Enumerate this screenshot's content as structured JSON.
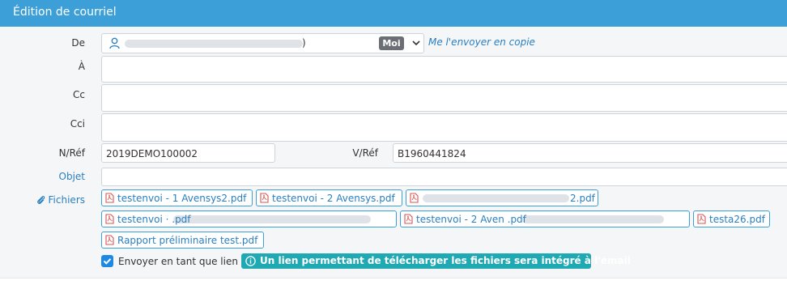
{
  "window": {
    "title": "Édition de courriel"
  },
  "labels": {
    "from": "De",
    "to": "À",
    "cc": "Cc",
    "bcc": "Cci",
    "nref": "N/Réf",
    "vref": "V/Réf",
    "subject": "Objet",
    "files": "Fichiers"
  },
  "from_field": {
    "visible_text": ")",
    "me_badge": "Moi",
    "copy_link": "Me l'envoyer en copie"
  },
  "fields": {
    "to": "",
    "cc": "",
    "bcc": "",
    "nref": "2019DEMO100002",
    "vref": "B1960441824",
    "subject": ""
  },
  "files": [
    {
      "text": "testenvoi - 1 Avensys2.pdf"
    },
    {
      "text": "testenvoi - 2 Avensys.pdf"
    },
    {
      "text": "2.pdf"
    },
    {
      "text": "testenvoi · .pdf"
    },
    {
      "text": "testenvoi - 2 Aven .pdf"
    },
    {
      "text": "testa26.pdf"
    },
    {
      "text": "Rapport préliminaire test.pdf"
    }
  ],
  "send_as_link": {
    "checked": true,
    "label": "Envoyer en tant que lien"
  },
  "info_badge": {
    "text": "Un lien permettant de télécharger les fichiers sera intégré à l'email"
  },
  "colors": {
    "header": "#3c9fd8",
    "link": "#2a7fc0",
    "info": "#1fa9b3",
    "pdf_icon": "#d9534f",
    "checkbox": "#1e88e5"
  },
  "icons": {
    "from_field": "user-icon",
    "files_label": "paperclip-icon",
    "file_chip": "pdf-file-icon",
    "info": "info-circle-icon"
  }
}
